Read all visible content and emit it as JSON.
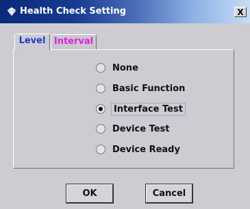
{
  "window": {
    "title": "Health Check Setting",
    "close_label": "X",
    "icon": "diamond-app-icon"
  },
  "tabs": [
    {
      "label": "Level",
      "selected": true,
      "color": "#1a3cc8"
    },
    {
      "label": "Interval",
      "selected": false,
      "color": "#e020e0"
    }
  ],
  "options": [
    {
      "label": "None",
      "checked": false
    },
    {
      "label": "Basic Function",
      "checked": false
    },
    {
      "label": "Interface Test",
      "checked": true
    },
    {
      "label": "Device Test",
      "checked": false
    },
    {
      "label": "Device Ready",
      "checked": false
    }
  ],
  "buttons": {
    "ok_label": "OK",
    "cancel_label": "Cancel"
  },
  "colors": {
    "titlebar_start": "#0a2a7a",
    "titlebar_end": "#c6dcf7",
    "dialog_background": "#ccccd2"
  }
}
